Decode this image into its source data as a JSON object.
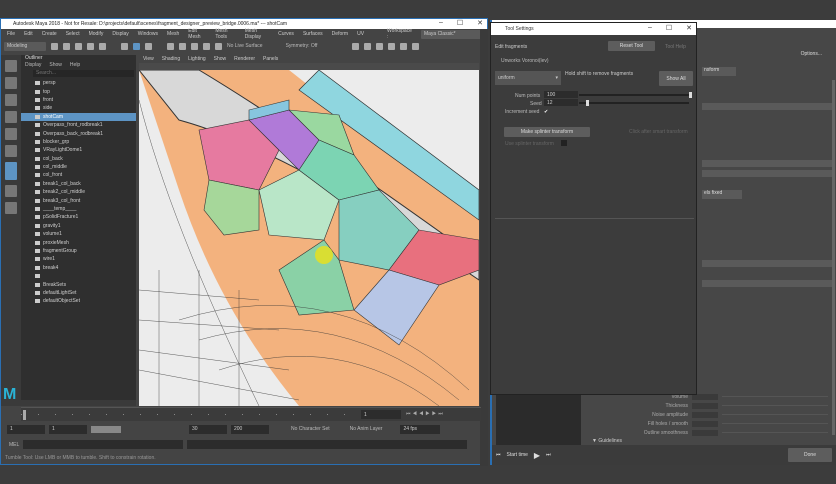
{
  "maya": {
    "title": "Autodesk Maya 2018 - Not for Resale: D:\\projects\\default\\scenes\\fragment_designer_preview_bridge.0006.ma* --- shotCam",
    "menus": [
      "File",
      "Edit",
      "Create",
      "Select",
      "Modify",
      "Display",
      "Windows",
      "Mesh",
      "Edit Mesh",
      "Mesh Tools",
      "Mesh Display",
      "Curves",
      "Surfaces",
      "Deform",
      "UV"
    ],
    "workspace_label": "Workspace :",
    "workspace_value": "Maya Classic*",
    "mode": "Modeling",
    "live_surface": "No Live Surface",
    "symmetry": "Symmetry: Off",
    "outliner": {
      "title": "Outliner",
      "menus": [
        "Display",
        "Show",
        "Help"
      ],
      "search_placeholder": "Search...",
      "items": [
        "persp",
        "top",
        "front",
        "side",
        "shotCam",
        "Overpass_front_rodbreak1",
        "Overpass_back_rodbreak1",
        "blocker_grp",
        "VRayLightDome1",
        "col_back",
        "col_middle",
        "col_front",
        "break1_col_back",
        "break2_col_middle",
        "break3_col_front",
        "____temp____",
        "pSolidFracture1",
        "gravity1",
        "volume1",
        "proxieMesh",
        "fragmentGroup",
        "wire1",
        "break4",
        "",
        "BreakSets",
        "defaultLightSet",
        "defaultObjectSet"
      ],
      "selected_index": 4
    },
    "viewport_menus": [
      "View",
      "Shading",
      "Lighting",
      "Show",
      "Renderer",
      "Panels"
    ],
    "timeline": {
      "current_frame": "1"
    },
    "range": {
      "start": "1",
      "start2": "1",
      "range_end": "30",
      "end": "200",
      "character_set": "No Character Set",
      "anim_layer": "No Anim Layer",
      "fps": "24 fps"
    },
    "mel_label": "MEL",
    "help_line": "Tumble Tool: Use LMB or MMB to tumble. Shift to constrain rotation."
  },
  "tool_settings": {
    "title": "Tool Settings",
    "header": "Edit fragments",
    "reset_tool": "Reset Tool",
    "tool_help": "Tool Help",
    "section": "Unworks Voronoi(lev)",
    "dropdown": "uniform",
    "hint": "Hold shift to remove fragments",
    "show_all": "Show All",
    "num_points_label": "Num points",
    "num_points": "100",
    "num_points_frac": 1.0,
    "seed_label": "Seed",
    "seed": "12",
    "seed_frac": 0.06,
    "increment_seed_label": "Increment seed",
    "increment_seed": "✔",
    "make_splinter": "Make splinter transform",
    "hint2": "Click after smart transform",
    "use_splinter": "Use splinter transform"
  },
  "fragment_window": {
    "options": "Options...",
    "btn1": "nsform",
    "btn2": "els fixed",
    "labels": [
      "Volume",
      "Thickness",
      "Noise amplitude",
      "Fill holes / smooth",
      "Outline smoothness"
    ],
    "section": "Guidelines",
    "start_label": "Start time",
    "done": "Done"
  },
  "colors": {
    "accent": "#5d94c4",
    "viewport_bg": "#e8e8e8"
  }
}
